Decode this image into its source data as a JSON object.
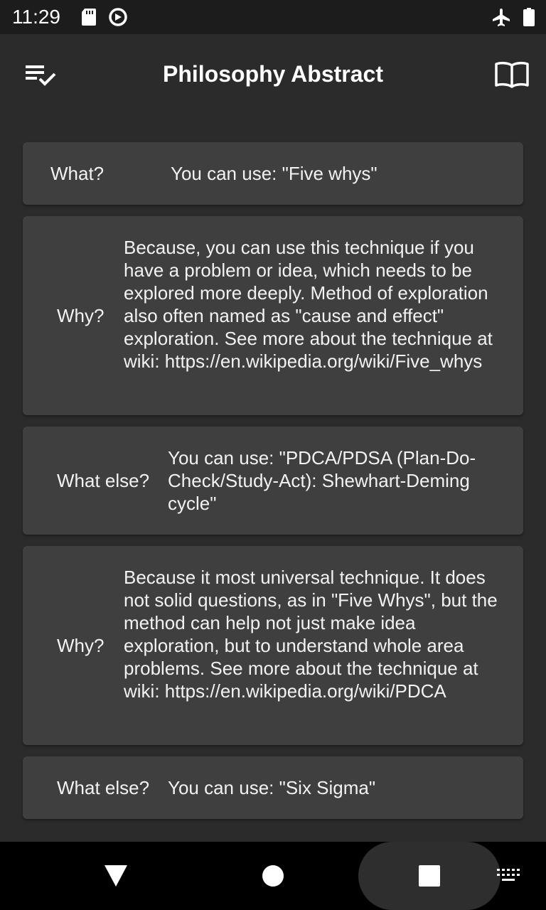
{
  "status_bar": {
    "time": "11:29"
  },
  "app_bar": {
    "title": "Philosophy Abstract"
  },
  "cards": [
    {
      "label": "What?",
      "text": "You can use: \"Five whys\""
    },
    {
      "label": "Why?",
      "text": "Because, you can use this technique if you have a problem or idea, which needs to be explored more deeply. Method of exploration also often named as \"cause and effect\" exploration. See more about the technique at wiki: https://en.wikipedia.org/wiki/Five_whys"
    },
    {
      "label": "What else?",
      "text": "You can use: \"PDCA/PDSA (Plan-Do-Check/Study-Act): Shewhart-Deming cycle\""
    },
    {
      "label": "Why?",
      "text": "Because it most universal technique. It does not solid questions, as in \"Five Whys\", but the method can help not just make idea exploration, but to understand whole area problems. See more about the technique at wiki: https://en.wikipedia.org/wiki/PDCA"
    },
    {
      "label": "What else?",
      "text": "You can use: \"Six Sigma\""
    }
  ],
  "icons": {
    "status": [
      "sd-card-icon",
      "sync-circle-icon",
      "airplane-mode-icon",
      "battery-icon"
    ],
    "app_bar": [
      "checklist-icon",
      "book-icon"
    ],
    "nav": [
      "back-triangle-icon",
      "home-circle-icon",
      "recents-square-icon",
      "keyboard-icon"
    ]
  },
  "colors": {
    "background": "#2b2b2b",
    "card": "#3f3f3f",
    "status_bar": "#1c1c1c",
    "nav_bar": "#000000"
  }
}
